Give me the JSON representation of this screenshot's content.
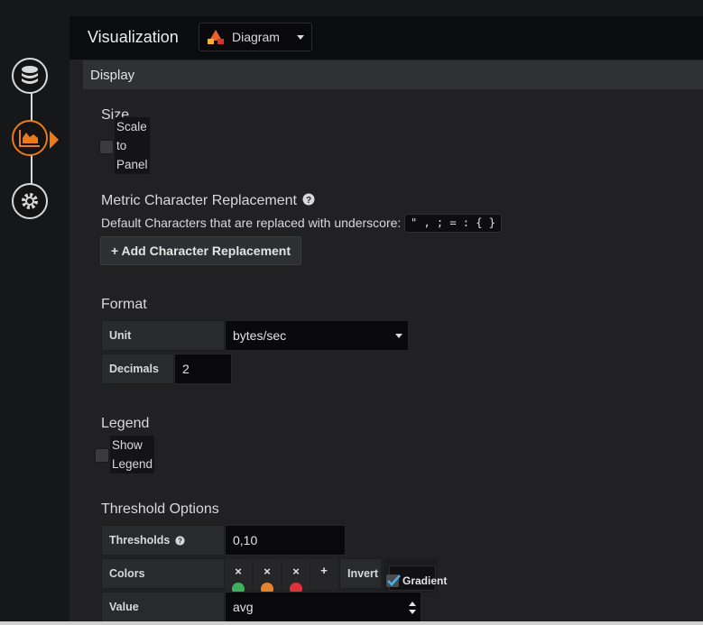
{
  "header": {
    "title": "Visualization",
    "picker_label": "Diagram"
  },
  "sidebar": {
    "steps": [
      {
        "icon": "database-icon"
      },
      {
        "icon": "chart-icon"
      },
      {
        "icon": "gear-icon"
      }
    ]
  },
  "display": {
    "section_title": "Display",
    "size": {
      "heading": "Size",
      "checkbox_label_lines": [
        "Scale",
        "to",
        "Panel"
      ]
    },
    "metric": {
      "heading": "Metric Character Replacement",
      "description": "Default Characters that are replaced with underscore:",
      "chars": "\" , ; = : { }",
      "add_button": "+ Add Character Replacement"
    },
    "format": {
      "heading": "Format",
      "unit_label": "Unit",
      "unit_value": "bytes/sec",
      "decimals_label": "Decimals",
      "decimals_value": "2"
    },
    "legend": {
      "heading": "Legend",
      "checkbox_label_lines": [
        "Show",
        "Legend"
      ]
    },
    "threshold": {
      "heading": "Threshold Options",
      "thresholds_label": "Thresholds",
      "thresholds_value": "0,10",
      "colors_label": "Colors",
      "colors": [
        "#3eb15b",
        "#e5832f",
        "#e0323a"
      ],
      "remove_glyph": "×",
      "add_glyph": "+",
      "invert_label": "Invert",
      "gradient_label": "Gradient",
      "value_label": "Value",
      "value_value": "avg"
    }
  }
}
